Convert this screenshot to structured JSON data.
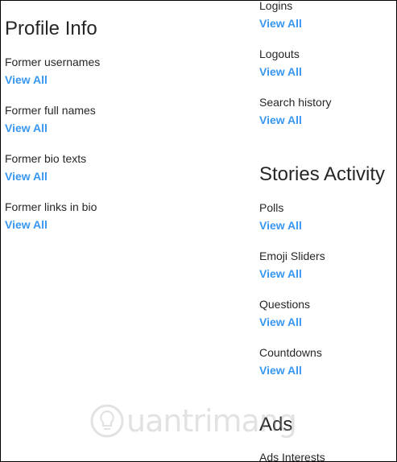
{
  "profile_info": {
    "title": "Profile Info",
    "items": [
      {
        "label": "Former usernames",
        "link": "View All"
      },
      {
        "label": "Former full names",
        "link": "View All"
      },
      {
        "label": "Former bio texts",
        "link": "View All"
      },
      {
        "label": "Former links in bio",
        "link": "View All"
      }
    ]
  },
  "account_activity": {
    "items": [
      {
        "label": "Logins",
        "link": "View All"
      },
      {
        "label": "Logouts",
        "link": "View All"
      },
      {
        "label": "Search history",
        "link": "View All"
      }
    ]
  },
  "stories_activity": {
    "title": "Stories Activity",
    "items": [
      {
        "label": "Polls",
        "link": "View All"
      },
      {
        "label": "Emoji Sliders",
        "link": "View All"
      },
      {
        "label": "Questions",
        "link": "View All"
      },
      {
        "label": "Countdowns",
        "link": "View All"
      }
    ]
  },
  "ads": {
    "title": "Ads",
    "items": [
      {
        "label": "Ads Interests"
      }
    ]
  },
  "watermark": {
    "text": "uantrimang",
    "icon": "lightbulb-logo-icon"
  },
  "colors": {
    "link": "#3897f0",
    "text": "#262626",
    "background": "#ffffff"
  }
}
